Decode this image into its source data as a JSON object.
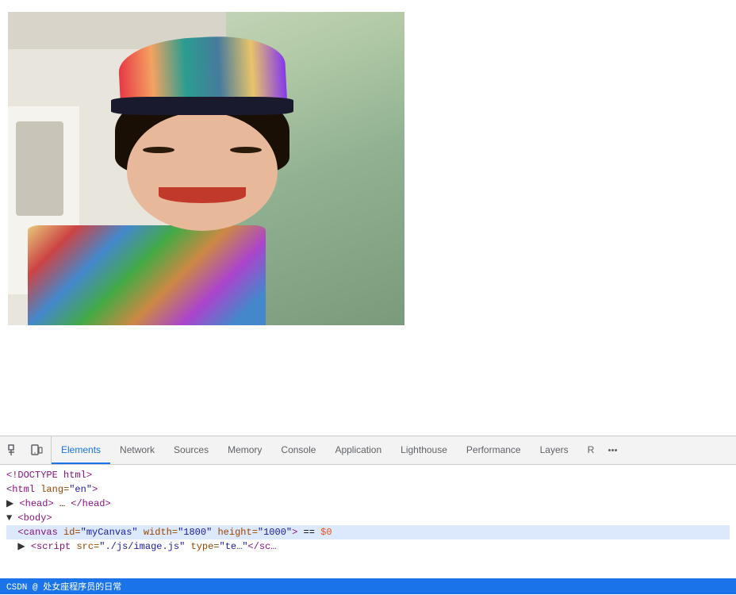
{
  "browser": {
    "content_bg": "#ffffff"
  },
  "photo": {
    "alt": "Woman smiling near white van with colorful hat"
  },
  "devtools": {
    "toolbar": {
      "inspect_icon": "⬚",
      "device_icon": "📱",
      "tabs": [
        {
          "id": "elements",
          "label": "Elements",
          "active": true
        },
        {
          "id": "network",
          "label": "Network",
          "active": false
        },
        {
          "id": "sources",
          "label": "Sources",
          "active": false
        },
        {
          "id": "memory",
          "label": "Memory",
          "active": false
        },
        {
          "id": "console",
          "label": "Console",
          "active": false
        },
        {
          "id": "application",
          "label": "Application",
          "active": false
        },
        {
          "id": "lighthouse",
          "label": "Lighthouse",
          "active": false
        },
        {
          "id": "performance",
          "label": "Performance",
          "active": false
        },
        {
          "id": "layers",
          "label": "Layers",
          "active": false
        },
        {
          "id": "recorder",
          "label": "R",
          "active": false
        }
      ]
    },
    "code": {
      "line1": "<!DOCTYPE html>",
      "line2_open": "<html lang=\"en\">",
      "line3_open": "▶ <head> … </head>",
      "line4_open": "▼ <body>",
      "line5_canvas": "<canvas id=\"myCanvas\" width=\"1800\" height=\"1000\"> == $0",
      "line6_script": "▶ <script src=\"./js/image.js\" type=\"te…</sc…"
    },
    "statusbar": {
      "left": "CSDN @ 处女座程序员的日常",
      "right": ""
    }
  }
}
